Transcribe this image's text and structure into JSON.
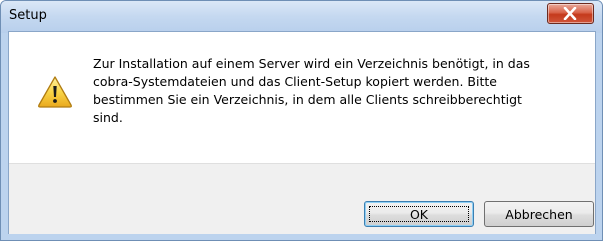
{
  "window": {
    "title": "Setup"
  },
  "dialog": {
    "icon": "warning-icon",
    "message": "Zur Installation auf einem Server wird ein Verzeichnis benötigt, in das\ncobra-Systemdateien und das Client-Setup kopiert werden. Bitte\nbestimmen Sie ein Verzeichnis, in dem alle Clients schreibberechtigt\nsind."
  },
  "buttons": {
    "ok_label": "OK",
    "cancel_label": "Abbrechen"
  },
  "colors": {
    "titlebar": "#c4d8f0",
    "close_button": "#c43a1c",
    "warning_yellow": "#f6c73a"
  }
}
